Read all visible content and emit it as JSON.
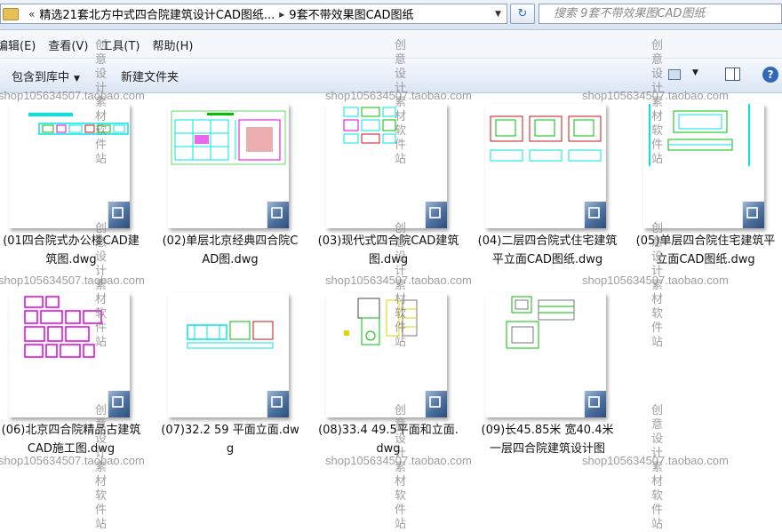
{
  "address": {
    "crumb_sep_1": "«",
    "crumb_1": "精选21套北方中式四合院建筑设计CAD图纸...",
    "crumb_sep_2": "▸",
    "crumb_2": "9套不带效果图CAD图纸",
    "dropdown_glyph": "▼",
    "refresh_glyph": "↻"
  },
  "search": {
    "placeholder": "搜索 9套不带效果图CAD图纸"
  },
  "menu": {
    "edit": "编辑(E)",
    "view": "查看(V)",
    "tools": "工具(T)",
    "help": "帮助(H)"
  },
  "commands": {
    "include_library": "包含到库中",
    "include_arrow": "▼",
    "new_folder": "新建文件夹",
    "view_arrow": "▼",
    "help_glyph": "?"
  },
  "files": [
    {
      "name": "(01四合院式办公楼CAD建筑图.dwg",
      "icon": "dwg-file-icon"
    },
    {
      "name": "(02)单层北京经典四合院CAD图.dwg",
      "icon": "dwg-file-icon"
    },
    {
      "name": "(03)现代式四合院CAD建筑图.dwg",
      "icon": "dwg-file-icon"
    },
    {
      "name": "(04)二层四合院式住宅建筑平立面CAD图纸.dwg",
      "icon": "dwg-file-icon"
    },
    {
      "name": "(05)单层四合院住宅建筑平立面CAD图纸.dwg",
      "icon": "dwg-file-icon"
    },
    {
      "name": "(06)北京四合院精品古建筑CAD施工图.dwg",
      "icon": "dwg-file-icon"
    },
    {
      "name": "(07)32.2 59 平面立面.dwg",
      "icon": "dwg-file-icon"
    },
    {
      "name": "(08)33.4 49.5平面和立面.dwg",
      "icon": "dwg-file-icon"
    },
    {
      "name": "(09)长45.85米 宽40.4米 一层四合院建筑设计图",
      "icon": "dwg-file-icon"
    }
  ],
  "watermark": {
    "url": "shop105634507.taobao.com",
    "vertical": "创意设计素材软件站"
  },
  "colors": {
    "accent": "#2f68b8",
    "cad_cyan": "#00e5e5",
    "cad_magenta": "#e000e0",
    "cad_red": "#c8141e",
    "cad_green": "#00c000"
  }
}
